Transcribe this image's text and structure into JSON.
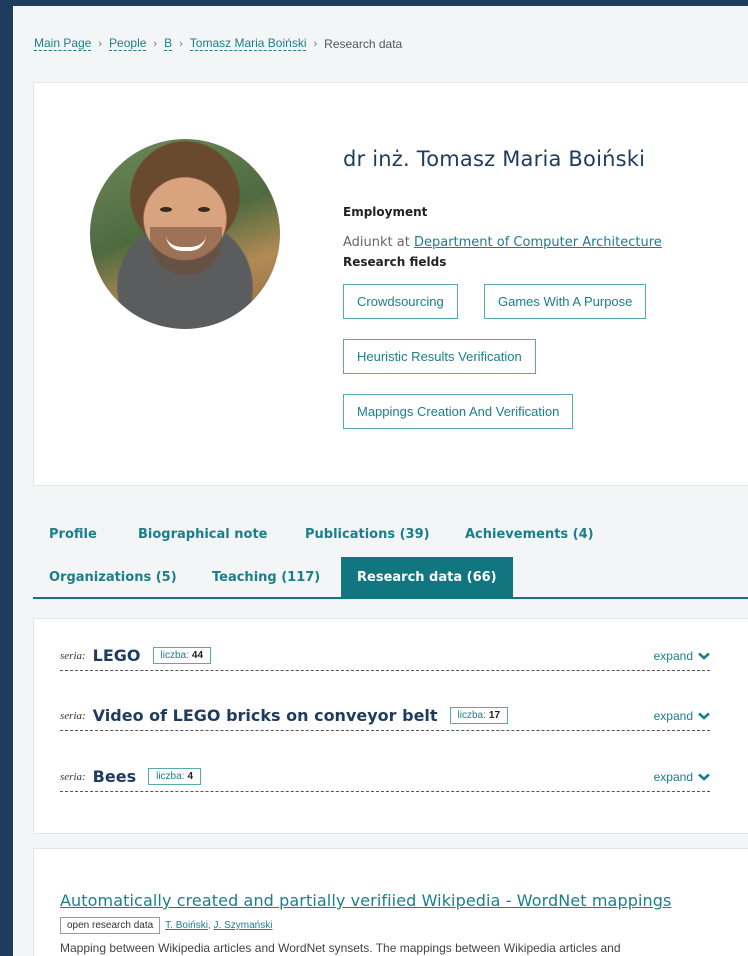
{
  "breadcrumb": {
    "items": [
      "Main Page",
      "People",
      "B",
      "Tomasz Maria Boiński"
    ],
    "current": "Research data",
    "separator": "›"
  },
  "profile": {
    "name": "dr inż. Tomasz Maria Boiński",
    "employment_label": "Employment",
    "employment_role": "Adiunkt at",
    "employment_unit": "Department of Computer Architecture",
    "research_fields_label": "Research fields",
    "research_fields": [
      "Crowdsourcing",
      "Games With A Purpose",
      "Heuristic Results Verification",
      "Mappings Creation And Verification"
    ]
  },
  "tabs": [
    {
      "label": "Profile"
    },
    {
      "label": "Biographical note"
    },
    {
      "label": "Publications (39)"
    },
    {
      "label": "Achievements (4)"
    },
    {
      "label": "Organizations (5)"
    },
    {
      "label": "Teaching (117)"
    },
    {
      "label": "Research data (66)",
      "active": true
    }
  ],
  "series": {
    "prefix": "seria:",
    "count_prefix": "liczba:",
    "expand_label": "expand",
    "items": [
      {
        "title": "LEGO",
        "count": "44"
      },
      {
        "title": "Video of LEGO bricks on conveyor belt",
        "count": "17"
      },
      {
        "title": "Bees",
        "count": "4"
      }
    ]
  },
  "dataset": {
    "title": "Automatically created and partially verifiied Wikipedia - WordNet mappings",
    "badge": "open research data",
    "authors": [
      "T. Boiński",
      "J. Szymański"
    ],
    "description": "Mapping between Wikipedia articles and WordNet synsets. The mappings between Wikipedia articles and"
  },
  "colors": {
    "accent": "#1a7f8a",
    "active_tab": "#117680",
    "heading": "#1f3b5e",
    "frame": "#1f3b5e"
  }
}
